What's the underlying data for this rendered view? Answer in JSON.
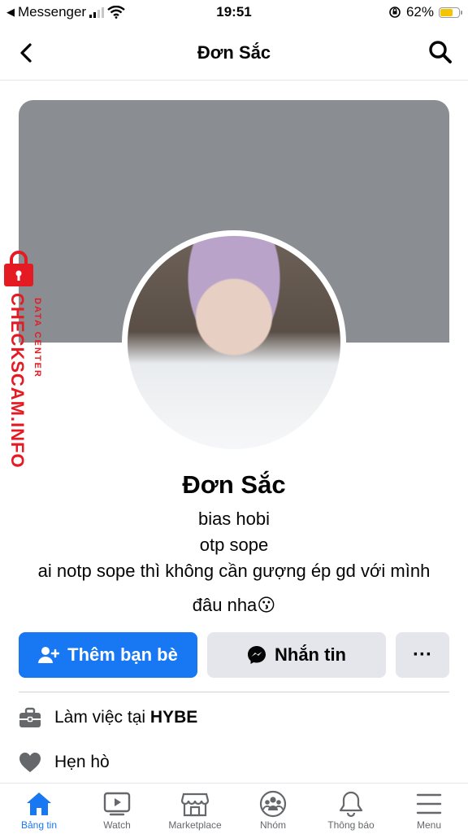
{
  "status_bar": {
    "back_app": "Messenger",
    "time": "19:51",
    "battery": "62%",
    "battery_level": 0.62
  },
  "header": {
    "title": "Đơn Sắc"
  },
  "watermark": {
    "brand": "CHECKSCAM.INFO",
    "sub": "DATA CENTER"
  },
  "profile": {
    "name": "Đơn Sắc",
    "bio_lines": [
      "bias hobi",
      "otp sope",
      "ai notp sope thì không cần gượng ép gd với mình",
      "đâu nha😗"
    ]
  },
  "actions": {
    "add_friend": "Thêm bạn bè",
    "message": "Nhắn tin",
    "more": "···"
  },
  "info": {
    "work_prefix": "Làm việc tại ",
    "work_place": "HYBE",
    "dating": "Hẹn hò"
  },
  "tabs": [
    {
      "label": "Bảng tin",
      "icon": "home-icon",
      "active": true
    },
    {
      "label": "Watch",
      "icon": "watch-icon",
      "active": false
    },
    {
      "label": "Marketplace",
      "icon": "marketplace-icon",
      "active": false
    },
    {
      "label": "Nhóm",
      "icon": "groups-icon",
      "active": false
    },
    {
      "label": "Thông báo",
      "icon": "bell-icon",
      "active": false
    },
    {
      "label": "Menu",
      "icon": "menu-icon",
      "active": false
    }
  ],
  "colors": {
    "accent": "#1877f2",
    "cover": "#8a8d91",
    "secondary_button": "#e4e6eb",
    "watermark": "#e51b23"
  }
}
